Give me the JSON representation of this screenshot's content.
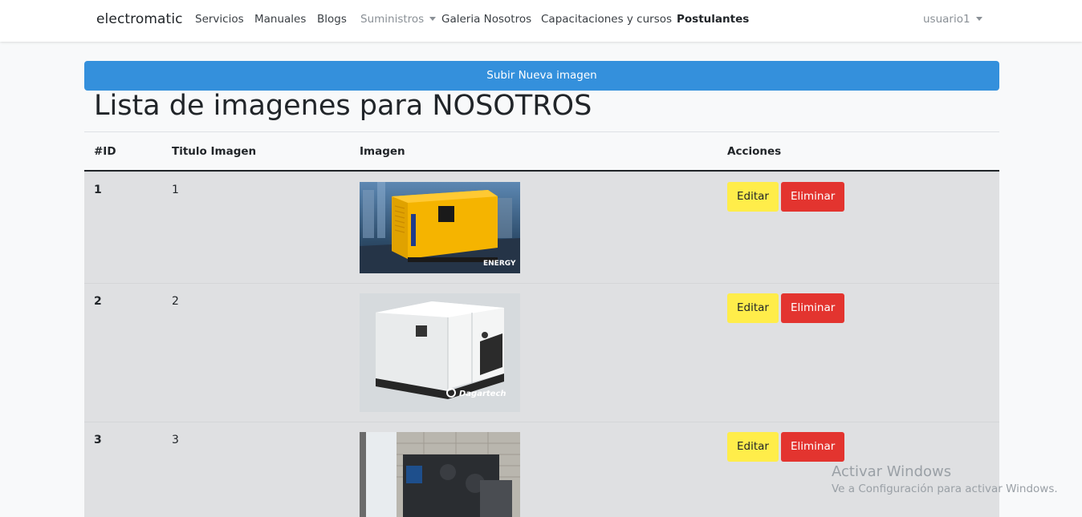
{
  "navbar": {
    "brand": "electromatic",
    "links": [
      {
        "label": "Servicios"
      },
      {
        "label": "Manuales"
      },
      {
        "label": "Blogs"
      },
      {
        "label": "Suministros"
      },
      {
        "label": "Galeria Nosotros"
      },
      {
        "label": "Capacitaciones y cursos"
      },
      {
        "label": "Postulantes"
      }
    ],
    "user": "usuario1"
  },
  "upload_button": "Subir Nueva imagen",
  "page_title": "Lista de imagenes para NOSOTROS",
  "table": {
    "headers": [
      "#ID",
      "Titulo Imagen",
      "Imagen",
      "Acciones"
    ],
    "rows": [
      {
        "id": "1",
        "title": "1",
        "image_brand": "ENERGY"
      },
      {
        "id": "2",
        "title": "2",
        "image_brand": "Dagartech"
      },
      {
        "id": "3",
        "title": "3"
      }
    ],
    "edit_label": "Editar",
    "delete_label": "Eliminar"
  },
  "watermark": {
    "title": "Activar Windows",
    "subtitle": "Ve a Configuración para activar Windows."
  },
  "colors": {
    "primary": "#3490dc",
    "warning": "#ffed4a",
    "danger": "#e3342f",
    "row_bg": "#dfe0e2"
  }
}
